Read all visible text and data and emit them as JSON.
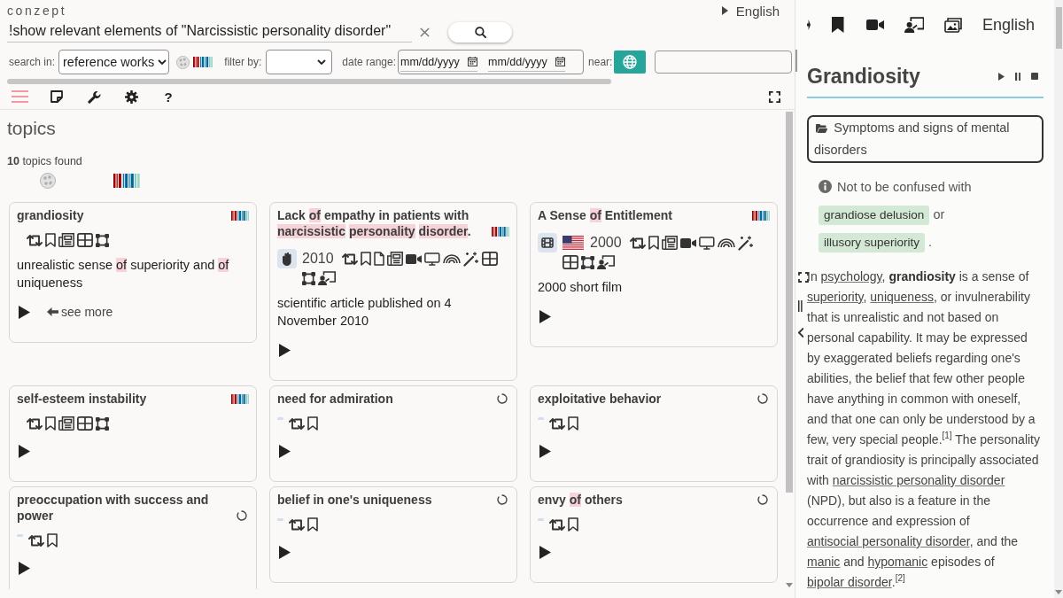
{
  "header": {
    "logo": "conzept",
    "language": "English"
  },
  "search": {
    "query": "!show relevant elements of \"Narcissistic personality disorder\""
  },
  "filters": {
    "search_in": {
      "label": "search in:",
      "value": "reference works"
    },
    "filter_by": {
      "label": "filter by:"
    },
    "date_range": {
      "label": "date range:",
      "from": {
        "placeholder": "mm/dd/yyyy"
      },
      "to": {
        "placeholder": "mm/dd/yyyy"
      }
    },
    "near": {
      "label": "near:"
    }
  },
  "toolbar": {
    "help": "?"
  },
  "topics": {
    "heading": "topics",
    "count": "**10** topics found",
    "cards": [
      {
        "kind": "loaded",
        "title": [
          {
            "text": "grandiosity",
            "highlight": false
          }
        ],
        "description": [
          {
            "text": "unrealistic sense ",
            "highlight": false
          },
          {
            "text": "of",
            "highlight": true
          },
          {
            "text": " superiority and ",
            "highlight": false
          },
          {
            "text": "of",
            "highlight": true
          },
          {
            "text": " uniqueness",
            "highlight": false
          }
        ],
        "see_more": "see more"
      },
      {
        "kind": "loaded",
        "title": [
          {
            "text": "Lack ",
            "highlight": false
          },
          {
            "text": "of",
            "highlight": true
          },
          {
            "text": " empathy in patients with ",
            "highlight": false
          },
          {
            "text": "narcissistic ",
            "highlight": true
          },
          {
            "text": "personality ",
            "highlight": true
          },
          {
            "text": "disorder",
            "highlight": true
          },
          {
            "text": ".",
            "highlight": false
          }
        ],
        "year": "2010",
        "description": [
          {
            "text": "scientific article published on 4 November 2010",
            "highlight": false
          }
        ]
      },
      {
        "kind": "loaded",
        "title": [
          {
            "text": "A Sense ",
            "highlight": false
          },
          {
            "text": "of",
            "highlight": true
          },
          {
            "text": " Entitlement",
            "highlight": false
          }
        ],
        "year": "2000",
        "description": [
          {
            "text": "2000 short film",
            "highlight": false
          }
        ]
      },
      {
        "kind": "loaded",
        "title": [
          {
            "text": "self-esteem instability",
            "highlight": false
          }
        ]
      },
      {
        "kind": "loading",
        "title": [
          {
            "text": "need for admiration",
            "highlight": false
          }
        ]
      },
      {
        "kind": "loading",
        "title": [
          {
            "text": "exploitative behavior",
            "highlight": false
          }
        ]
      },
      {
        "kind": "loading",
        "title": [
          {
            "text": "preoccupation with success and power",
            "highlight": false
          }
        ]
      },
      {
        "kind": "loading",
        "title": [
          {
            "text": "belief in one's uniqueness",
            "highlight": false
          }
        ]
      },
      {
        "kind": "loading",
        "title": [
          {
            "text": "envy ",
            "highlight": false
          },
          {
            "text": "of",
            "highlight": true
          },
          {
            "text": " others",
            "highlight": false
          }
        ]
      }
    ]
  },
  "article": {
    "language": "English",
    "title": "Grandiosity",
    "category": "Symptoms and signs of mental disorders",
    "notice": [
      {
        "kind": "text",
        "text": "Not to be confused with"
      },
      {
        "kind": "tag",
        "text": "grandiose delusion"
      },
      {
        "kind": "text",
        "text": "or"
      },
      {
        "kind": "tag",
        "text": "illusory superiority"
      },
      {
        "kind": "text",
        "text": "."
      }
    ],
    "paragraph": [
      {
        "kind": "text",
        "text": "In "
      },
      {
        "kind": "link",
        "text": "psychology"
      },
      {
        "kind": "text",
        "text": ", **grandiosity** is a sense of "
      },
      {
        "kind": "link",
        "text": "superiority"
      },
      {
        "kind": "text",
        "text": ", "
      },
      {
        "kind": "link",
        "text": "uniqueness"
      },
      {
        "kind": "text",
        "text": ", or invulnerability that is unrealistic and not based on personal capability. It may be expressed by exaggerated beliefs regarding one's abilities, the belief that few other people have anything in common with oneself, and that one can only be understood by a few, very special people.$^{[1]}$ The personality trait of grandiosity is principally associated with "
      },
      {
        "kind": "link",
        "text": "narcissistic personality disorder"
      },
      {
        "kind": "text",
        "text": " (NPD), but also is a feature in the occurrence and expression of "
      },
      {
        "kind": "link",
        "text": "antisocial personality disorder"
      },
      {
        "kind": "text",
        "text": ", and the "
      },
      {
        "kind": "link",
        "text": "manic"
      },
      {
        "kind": "text",
        "text": " and "
      },
      {
        "kind": "link",
        "text": "hypomanic"
      },
      {
        "kind": "text",
        "text": " episodes of "
      },
      {
        "kind": "link",
        "text": "bipolar disorder"
      },
      {
        "kind": "text",
        "text": ".$^{[2]}$"
      }
    ]
  }
}
